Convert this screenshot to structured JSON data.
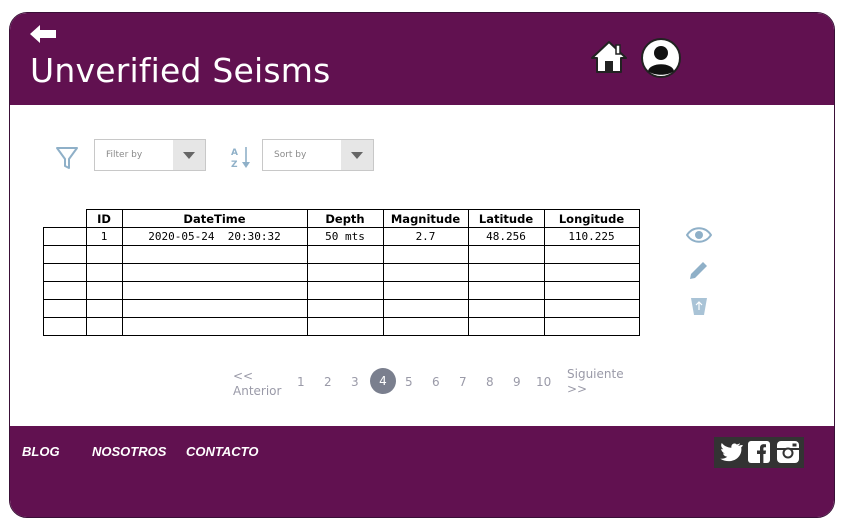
{
  "header": {
    "title": "Unverified Seisms",
    "back_icon": "back-arrow-icon",
    "home_icon": "home-icon",
    "profile_icon": "user-profile-icon"
  },
  "toolbar": {
    "filter_placeholder": "Filter by",
    "sort_placeholder": "Sort by"
  },
  "table": {
    "columns": [
      "ID",
      "DateTime",
      "Depth",
      "Magnitude",
      "Latitude",
      "Longitude"
    ],
    "rows": [
      [
        "1",
        "2020-05-24  20:30:32",
        "50 mts",
        "2.7",
        "48.256",
        "110.225"
      ],
      [
        "",
        "",
        "",
        "",
        "",
        ""
      ],
      [
        "",
        "",
        "",
        "",
        "",
        ""
      ],
      [
        "",
        "",
        "",
        "",
        "",
        ""
      ],
      [
        "",
        "",
        "",
        "",
        "",
        ""
      ],
      [
        "",
        "",
        "",
        "",
        "",
        ""
      ]
    ]
  },
  "actions": [
    "view-icon",
    "edit-icon",
    "delete-icon"
  ],
  "pagination": {
    "prev_line1": "<<",
    "prev_line2": "Anterior",
    "pages": [
      "1",
      "2",
      "3",
      "4",
      "5",
      "6",
      "7",
      "8",
      "9",
      "10"
    ],
    "active": "4",
    "next_line1": "Siguiente",
    "next_line2": ">>"
  },
  "footer": {
    "links": [
      "BLOG",
      "NOSOTROS",
      "CONTACTO"
    ],
    "social_icons": [
      "twitter-icon",
      "facebook-icon",
      "instagram-icon"
    ]
  },
  "colors": {
    "brand": "#611150",
    "icon_blue": "#8fb0c8",
    "active_page": "#7a7f8e"
  }
}
